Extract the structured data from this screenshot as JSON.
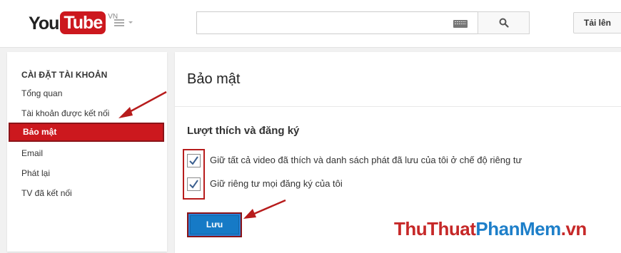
{
  "header": {
    "logo_you": "You",
    "logo_tube": "Tube",
    "logo_region": "VN",
    "search_value": "",
    "upload_label": "Tải lên"
  },
  "sidebar": {
    "heading": "CÀI ĐẶT TÀI KHOẢN",
    "items": [
      {
        "label": "Tổng quan",
        "active": false
      },
      {
        "label": "Tài khoản được kết nối",
        "active": false
      },
      {
        "label": "Bảo mật",
        "active": true
      },
      {
        "label": "Email",
        "active": false
      },
      {
        "label": "Phát lại",
        "active": false
      },
      {
        "label": "TV đã kết nối",
        "active": false
      }
    ]
  },
  "main": {
    "title": "Bảo mật",
    "section_title": "Lượt thích và đăng ký",
    "options": [
      {
        "label": "Giữ tất cả video đã thích và danh sách phát đã lưu của tôi ở chế độ riêng tư",
        "checked": true
      },
      {
        "label": "Giữ riêng tư mọi đăng ký của tôi",
        "checked": true
      }
    ],
    "save_label": "Lưu"
  },
  "watermark": {
    "part_a": "ThuThuat",
    "part_b": "PhanMem",
    "part_c": ".vn"
  },
  "colors": {
    "brand_red": "#cc181e",
    "save_blue": "#167ac6",
    "annotation_red": "#b71c1c"
  }
}
